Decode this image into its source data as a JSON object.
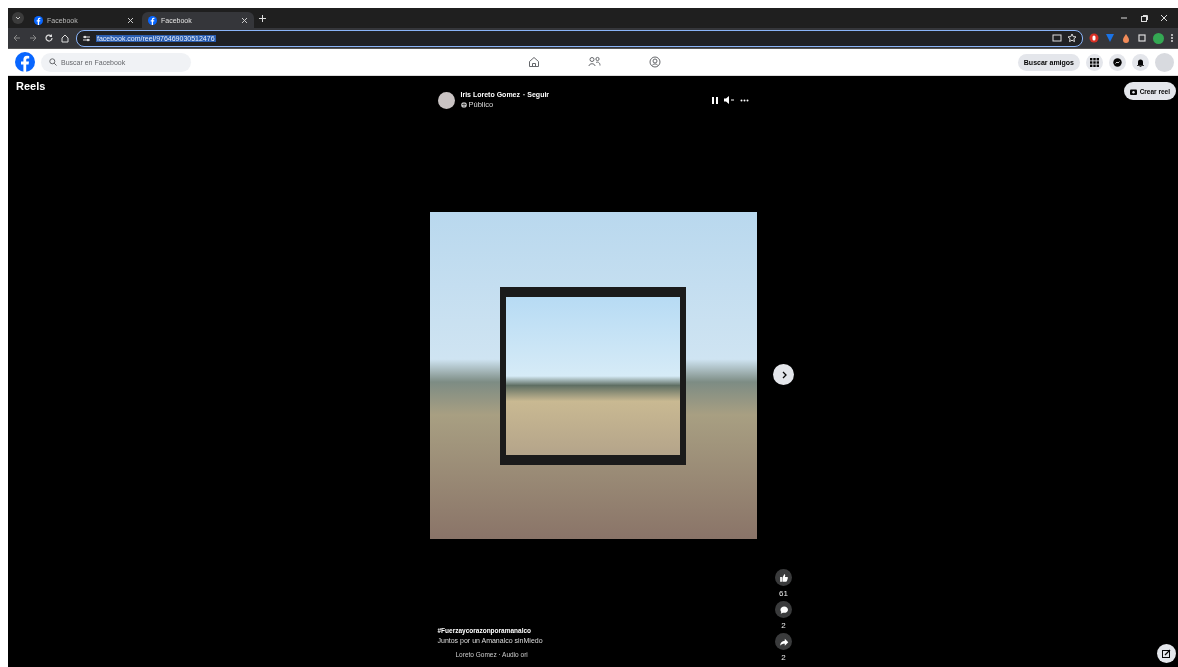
{
  "browser": {
    "tabs": [
      {
        "title": "Facebook",
        "selected": false
      },
      {
        "title": "Facebook",
        "selected": true
      }
    ],
    "url": "facebook.com/reel/976469030512476"
  },
  "navbar": {
    "search": {
      "placeholder": "Buscar en Facebook"
    },
    "find_friends": "Buscar amigos"
  },
  "reels": {
    "title": "Reels",
    "create_button": "Crear reel",
    "author": "Iris Loreto Gomez",
    "follow": "· Seguir",
    "privacy": "Público",
    "hashtag": "#Fuerzaycorazonporamanalco",
    "caption": "Juntos por un Amanalco sinMiedo",
    "audio": "Loreto Gomez · Audio ori",
    "actions": [
      {
        "kind": "like",
        "count": "61"
      },
      {
        "kind": "comment",
        "count": "2"
      },
      {
        "kind": "share",
        "count": "2"
      }
    ]
  }
}
